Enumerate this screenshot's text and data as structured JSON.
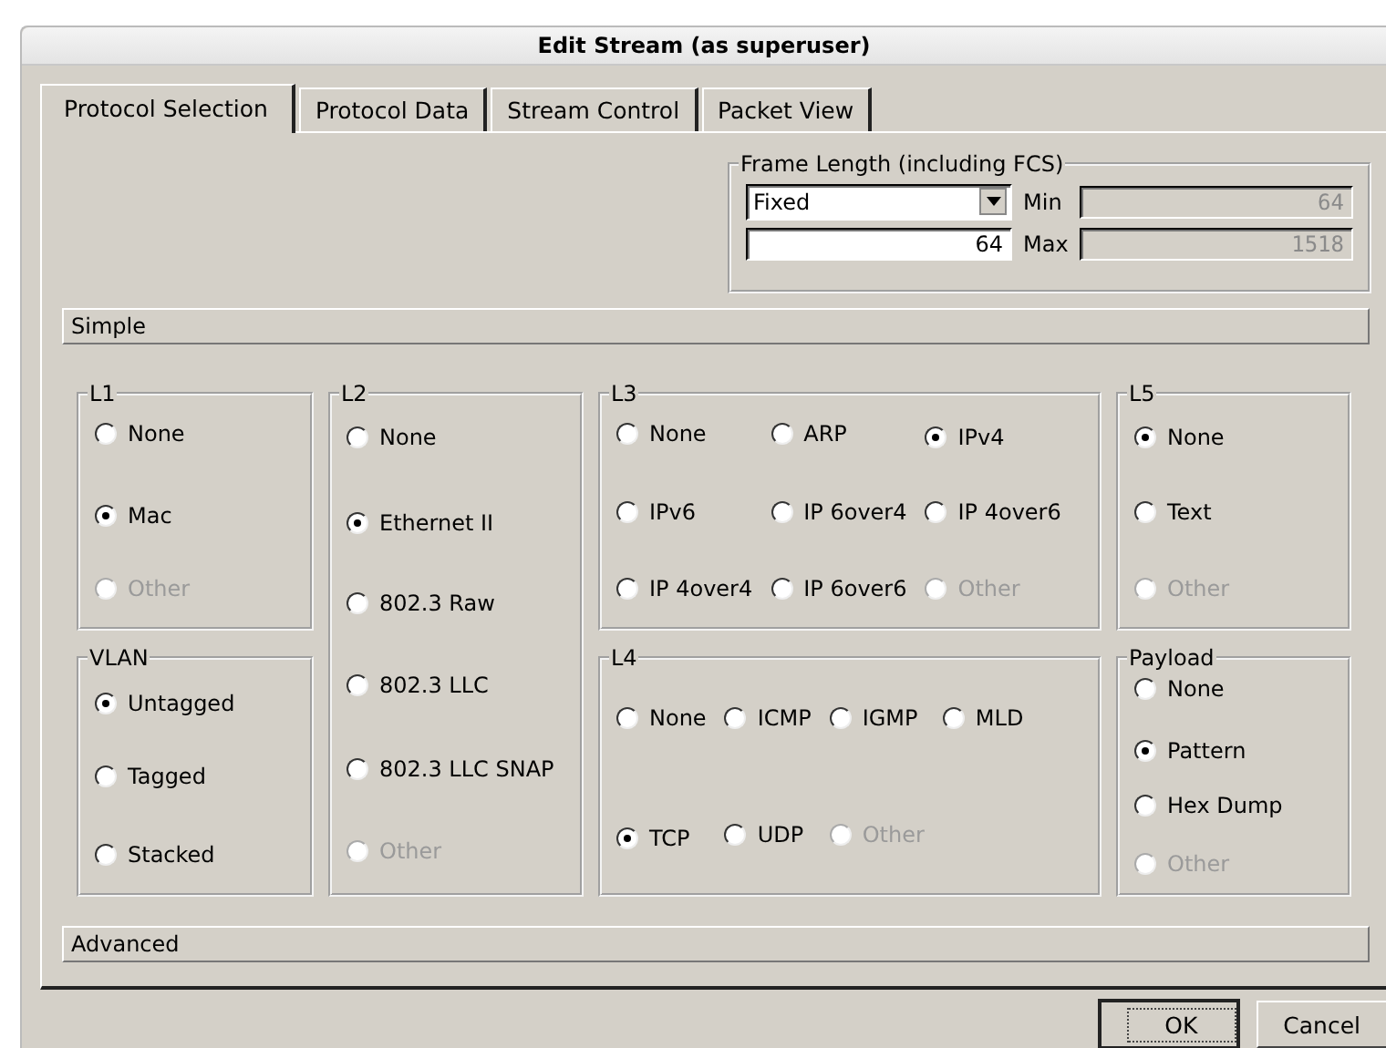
{
  "window": {
    "title": "Edit Stream (as superuser)"
  },
  "tabs": [
    {
      "label": "Protocol Selection",
      "selected": true
    },
    {
      "label": "Protocol Data",
      "selected": false
    },
    {
      "label": "Stream Control",
      "selected": false
    },
    {
      "label": "Packet View",
      "selected": false
    }
  ],
  "frame_length": {
    "title": "Frame Length (including FCS)",
    "mode": "Fixed",
    "value": "64",
    "min_label": "Min",
    "min": "64",
    "max_label": "Max",
    "max": "1518"
  },
  "simple_section": {
    "title": "Simple"
  },
  "columns": [
    [
      {
        "title": "L1",
        "rows": [
          [
            {
              "label": "None",
              "selected": false,
              "disabled": false
            }
          ],
          [
            {
              "label": "Mac",
              "selected": true,
              "disabled": false
            }
          ],
          [
            {
              "label": "Other",
              "selected": false,
              "disabled": true
            }
          ]
        ]
      },
      {
        "title": "VLAN",
        "rows": [
          [
            {
              "label": "Untagged",
              "selected": true,
              "disabled": false
            }
          ],
          [
            {
              "label": "Tagged",
              "selected": false,
              "disabled": false
            }
          ],
          [
            {
              "label": "Stacked",
              "selected": false,
              "disabled": false
            }
          ]
        ]
      }
    ],
    [
      {
        "title": "L2",
        "rows": [
          [
            {
              "label": "None",
              "selected": false,
              "disabled": false
            }
          ],
          [
            {
              "label": "Ethernet II",
              "selected": true,
              "disabled": false
            }
          ],
          [
            {
              "label": "802.3 Raw",
              "selected": false,
              "disabled": false
            }
          ],
          [
            {
              "label": "802.3 LLC",
              "selected": false,
              "disabled": false
            }
          ],
          [
            {
              "label": "802.3 LLC SNAP",
              "selected": false,
              "disabled": false
            }
          ],
          [
            {
              "label": "Other",
              "selected": false,
              "disabled": true
            }
          ]
        ]
      }
    ],
    [
      {
        "title": "L3",
        "rows": [
          [
            {
              "label": "None",
              "selected": false,
              "disabled": false
            },
            {
              "label": "ARP",
              "selected": false,
              "disabled": false
            },
            {
              "label": "IPv4",
              "selected": true,
              "disabled": false
            }
          ],
          [
            {
              "label": "IPv6",
              "selected": false,
              "disabled": false
            },
            {
              "label": "IP 6over4",
              "selected": false,
              "disabled": false
            },
            {
              "label": "IP 4over6",
              "selected": false,
              "disabled": false
            }
          ],
          [
            {
              "label": "IP 4over4",
              "selected": false,
              "disabled": false
            },
            {
              "label": "IP 6over6",
              "selected": false,
              "disabled": false
            },
            {
              "label": "Other",
              "selected": false,
              "disabled": true
            }
          ]
        ]
      },
      {
        "title": "L4",
        "rows": [
          [
            {
              "label": "None",
              "selected": false,
              "disabled": false
            },
            {
              "label": "ICMP",
              "selected": false,
              "disabled": false
            },
            {
              "label": "IGMP",
              "selected": false,
              "disabled": false
            },
            {
              "label": "MLD",
              "selected": false,
              "disabled": false
            }
          ],
          [
            {
              "label": "TCP",
              "selected": true,
              "disabled": false
            },
            {
              "label": "UDP",
              "selected": false,
              "disabled": false
            },
            {
              "label": "Other",
              "selected": false,
              "disabled": true
            }
          ]
        ]
      }
    ],
    [
      {
        "title": "L5",
        "rows": [
          [
            {
              "label": "None",
              "selected": true,
              "disabled": false
            }
          ],
          [
            {
              "label": "Text",
              "selected": false,
              "disabled": false
            }
          ],
          [
            {
              "label": "Other",
              "selected": false,
              "disabled": true
            }
          ]
        ]
      },
      {
        "title": "Payload",
        "rows": [
          [
            {
              "label": "None",
              "selected": false,
              "disabled": false
            }
          ],
          [
            {
              "label": "Pattern",
              "selected": true,
              "disabled": false
            }
          ],
          [
            {
              "label": "Hex Dump",
              "selected": false,
              "disabled": false
            }
          ],
          [
            {
              "label": "Other",
              "selected": false,
              "disabled": true
            }
          ]
        ]
      }
    ]
  ],
  "advanced_section": {
    "title": "Advanced"
  },
  "buttons": [
    {
      "label": "OK",
      "kind": "default"
    },
    {
      "label": "Cancel",
      "kind": "normal"
    }
  ]
}
